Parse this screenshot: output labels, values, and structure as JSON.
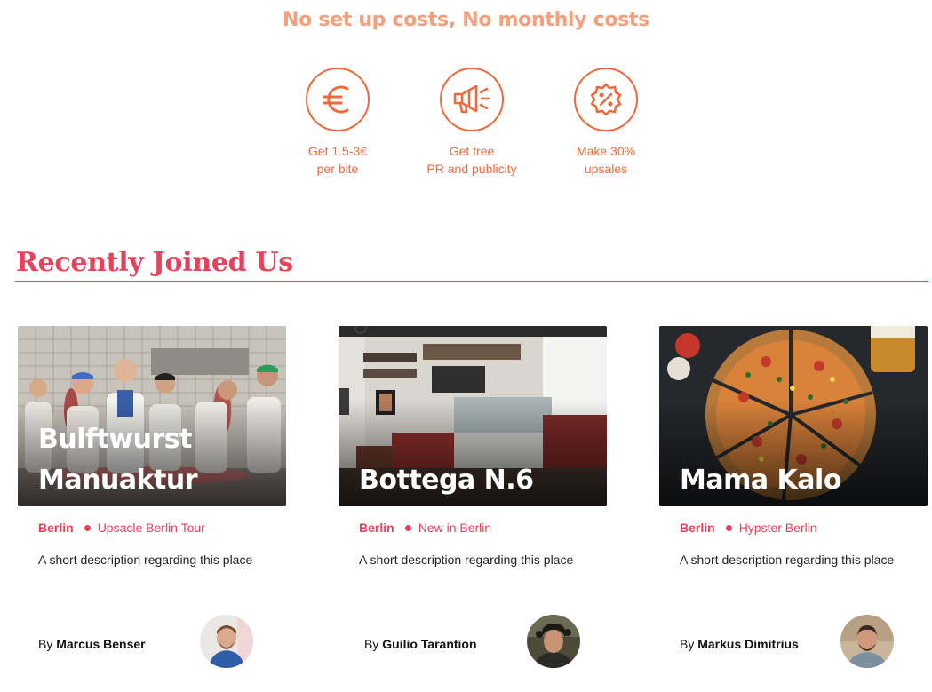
{
  "hero": {
    "title": "No set up costs, No monthly costs"
  },
  "benefits": [
    {
      "icon": "euro-icon",
      "label": "Get 1.5-3€\nper bite"
    },
    {
      "icon": "megaphone-icon",
      "label": "Get free\nPR and publicity"
    },
    {
      "icon": "percent-badge-icon",
      "label": "Make 30%\nupsales"
    }
  ],
  "recent": {
    "title": "Recently Joined Us",
    "cards": [
      {
        "name": "Bulftwurst Manuaktur",
        "city": "Berlin",
        "tag": "Upsacle Berlin Tour",
        "description": "A short description regarding this place",
        "by": "By",
        "author": "Marcus Benser"
      },
      {
        "name": "Bottega N.6",
        "city": "Berlin",
        "tag": "New in Berlin",
        "description": "A short description regarding this place",
        "by": "By",
        "author": "Guilio Tarantion"
      },
      {
        "name": "Mama Kalo",
        "city": "Berlin",
        "tag": "Hypster Berlin",
        "description": "A short description regarding this place",
        "by": "By",
        "author": "Markus Dimitrius"
      }
    ]
  },
  "colors": {
    "accent": "#e8415a",
    "orange": "#ee6a3c",
    "hero_text": "#f2a07e"
  }
}
